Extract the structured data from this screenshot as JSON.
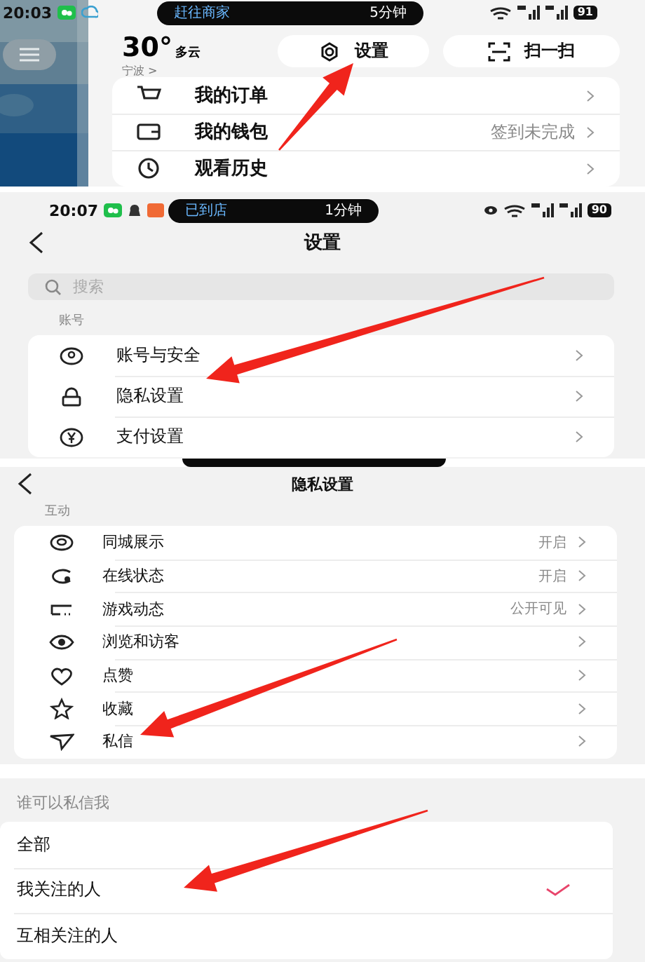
{
  "screen_1": {
    "status_bar": {
      "time": "20:03",
      "activity": "赶往商家",
      "duration": "5分钟",
      "battery": "91"
    },
    "weather": {
      "temperature": "30°",
      "condition": "多云",
      "city": "宁波 >"
    },
    "buttons": [
      {
        "label": "设置"
      },
      {
        "label": "扫一扫"
      }
    ],
    "menu": [
      {
        "label": "我的订单"
      },
      {
        "label": "我的钱包",
        "value": "签到未完成"
      },
      {
        "label": "观看历史"
      }
    ]
  },
  "screen_2": {
    "status_bar": {
      "time": "20:07",
      "activity": "已到店",
      "duration": "1分钟",
      "battery": "90"
    },
    "title": "设置",
    "search": {
      "placeholder": "搜索"
    },
    "section": "账号",
    "items": [
      {
        "label": "账号与安全"
      },
      {
        "label": "隐私设置"
      },
      {
        "label": "支付设置"
      }
    ]
  },
  "screen_3": {
    "title": "隐私设置",
    "section": "互动",
    "items": [
      {
        "label": "同城展示",
        "value": "开启"
      },
      {
        "label": "在线状态",
        "value": "开启"
      },
      {
        "label": "游戏动态",
        "value": "公开可见"
      },
      {
        "label": "浏览和访客"
      },
      {
        "label": "点赞"
      },
      {
        "label": "收藏"
      },
      {
        "label": "私信"
      }
    ]
  },
  "screen_4": {
    "section": "谁可以私信我",
    "options": [
      {
        "label": "全部",
        "selected": false
      },
      {
        "label": "我关注的人",
        "selected": true
      },
      {
        "label": "互相关注的人",
        "selected": false
      }
    ]
  }
}
